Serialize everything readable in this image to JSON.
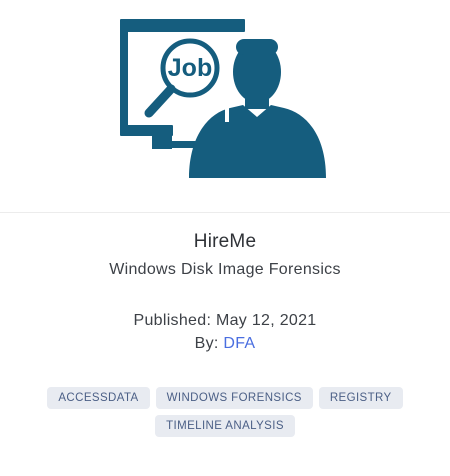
{
  "hero": {
    "image_label": "Job",
    "icon": "job-search-person-icon",
    "color": "#155d7e"
  },
  "post": {
    "title": "HireMe",
    "subtitle": "Windows Disk Image Forensics",
    "published_label": "Published: May 12, 2021",
    "by_prefix": "By:",
    "author": "DFA"
  },
  "tags": [
    "ACCESSDATA",
    "WINDOWS FORENSICS",
    "REGISTRY",
    "TIMELINE ANALYSIS"
  ]
}
